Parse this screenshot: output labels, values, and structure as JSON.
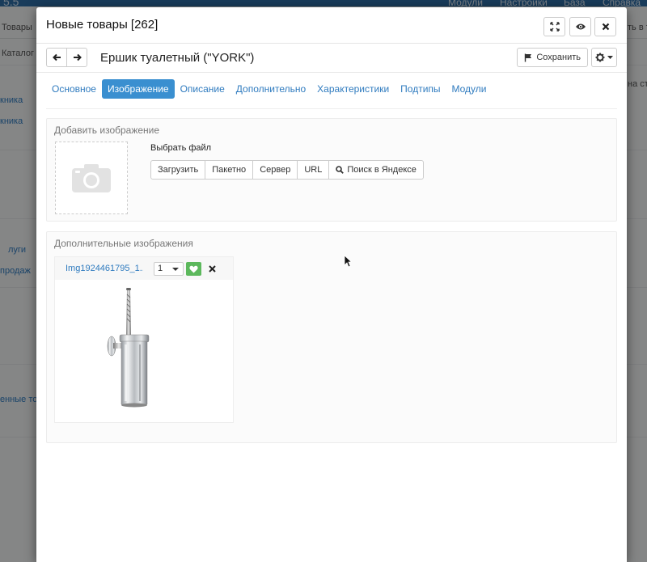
{
  "background": {
    "version": "5.5",
    "menus": [
      "Модули",
      "Настройки",
      "База",
      "Справка"
    ],
    "crumb": "Товары",
    "catalog": "Каталог",
    "links": [
      "кника",
      "кника",
      "луги",
      "продаж",
      "енные то"
    ],
    "right_text_1": "ть в т",
    "right_text_2": "на стр"
  },
  "modal": {
    "title": "Новые товары [262]",
    "product_name": "Ершик туалетный (\"YORK\")",
    "save_label": "Сохранить"
  },
  "tabs": [
    {
      "label": "Основное",
      "active": false
    },
    {
      "label": "Изображение",
      "active": true
    },
    {
      "label": "Описание",
      "active": false
    },
    {
      "label": "Дополнительно",
      "active": false
    },
    {
      "label": "Характеристики",
      "active": false
    },
    {
      "label": "Подтипы",
      "active": false
    },
    {
      "label": "Модули",
      "active": false
    }
  ],
  "add_image": {
    "title": "Добавить изображение",
    "choose_file_label": "Выбрать файл",
    "buttons": [
      "Загрузить",
      "Пакетно",
      "Сервер",
      "URL",
      "Поиск в Яндексе"
    ]
  },
  "extra_images": {
    "title": "Дополнительные изображения",
    "items": [
      {
        "filename": "Img1924461795_1..",
        "order": "1"
      }
    ]
  },
  "colors": {
    "accent": "#3a8fd0",
    "link": "#2f7bbf",
    "favorite": "#5cb85c"
  },
  "icons": {
    "fullscreen": "expand-icon",
    "preview": "eye-icon",
    "close": "close-icon",
    "prev": "arrow-left-icon",
    "next": "arrow-right-icon",
    "save": "flag-icon",
    "settings": "gear-icon",
    "search": "search-icon",
    "favorite": "heart-icon",
    "delete": "close-icon",
    "placeholder": "camera-icon"
  }
}
